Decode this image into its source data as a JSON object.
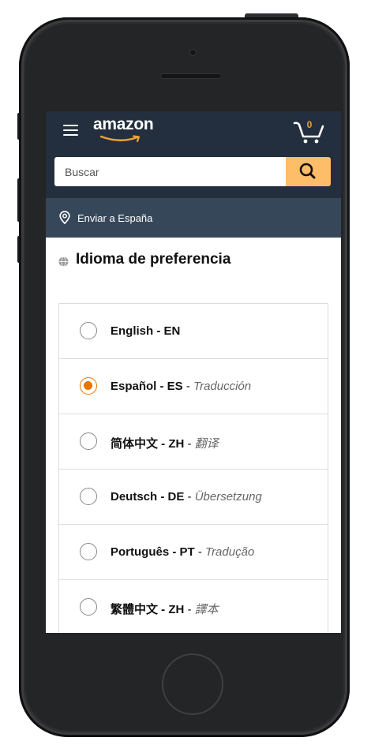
{
  "header": {
    "logo_text": "amazon",
    "cart_count": "0",
    "cart_icon": "cart-icon",
    "menu_icon": "hamburger-icon"
  },
  "search": {
    "placeholder": "Buscar",
    "icon": "search-icon"
  },
  "delivery": {
    "text": "Enviar a España",
    "icon": "location-pin-icon"
  },
  "language_section": {
    "title": "Idioma de preferencia",
    "icon": "globe-icon",
    "options": [
      {
        "name": "English - EN",
        "translation": "",
        "selected": false
      },
      {
        "name": "Español - ES",
        "translation": "Traducción",
        "selected": true
      },
      {
        "name": "简体中文 - ZH",
        "translation": "翻译",
        "selected": false
      },
      {
        "name": "Deutsch - DE",
        "translation": "Übersetzung",
        "selected": false
      },
      {
        "name": "Português - PT",
        "translation": "Tradução",
        "selected": false
      },
      {
        "name": "繁體中文 - ZH",
        "translation": "譯本",
        "selected": false
      }
    ]
  },
  "colors": {
    "header_bg": "#232f3e",
    "subheader_bg": "#37475a",
    "search_button": "#febd69",
    "radio_selected": "#e77600",
    "cart_count": "#f0a038"
  }
}
